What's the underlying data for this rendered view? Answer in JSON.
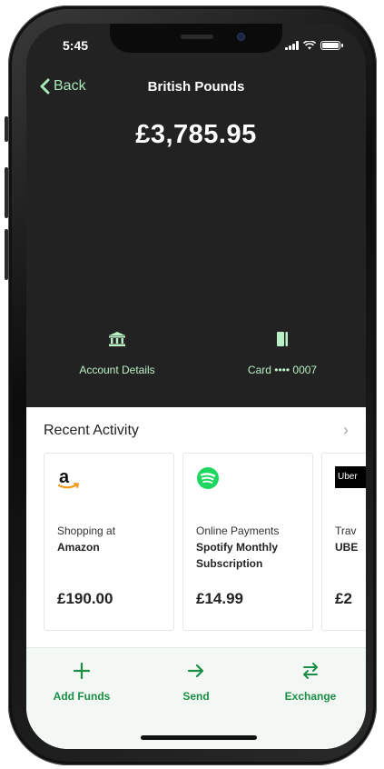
{
  "status_bar": {
    "time": "5:45"
  },
  "nav": {
    "back_label": "Back",
    "title": "British Pounds"
  },
  "account": {
    "balance": "£3,785.95"
  },
  "quick_actions": {
    "account_details_label": "Account Details",
    "card_label": "Card •••• 0007"
  },
  "recent_activity": {
    "title": "Recent Activity",
    "items": [
      {
        "logo": "amazon-logo",
        "category": "Shopping at",
        "merchant": "Amazon",
        "amount": "£190.00"
      },
      {
        "logo": "spotify-logo",
        "category": "Online Payments",
        "merchant": "Spotify Monthly Subscription",
        "amount": "£14.99"
      },
      {
        "logo": "uber-logo",
        "logo_text": "Uber",
        "category": "Trav",
        "merchant": "UBE",
        "amount": "£2"
      }
    ]
  },
  "bottom_bar": {
    "add_funds_label": "Add Funds",
    "send_label": "Send",
    "exchange_label": "Exchange"
  },
  "colors": {
    "accent_green": "#1a8e45",
    "light_green": "#b9f0c6",
    "dark_bg": "#222222"
  }
}
